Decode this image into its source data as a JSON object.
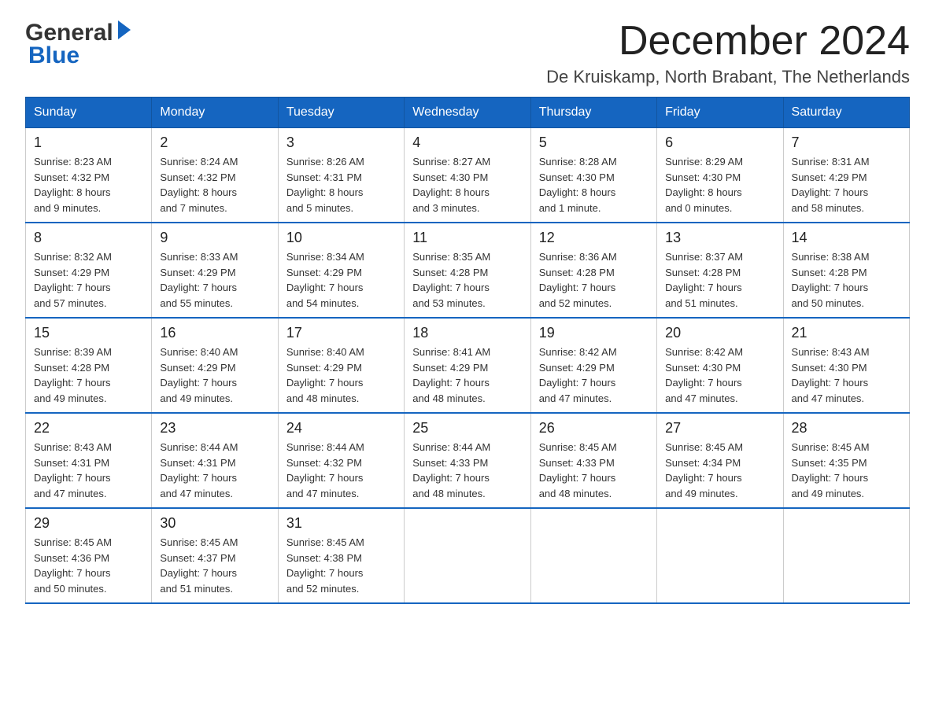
{
  "logo": {
    "general": "General",
    "blue": "Blue"
  },
  "title": "December 2024",
  "subtitle": "De Kruiskamp, North Brabant, The Netherlands",
  "weekdays": [
    "Sunday",
    "Monday",
    "Tuesday",
    "Wednesday",
    "Thursday",
    "Friday",
    "Saturday"
  ],
  "weeks": [
    [
      {
        "day": "1",
        "sunrise": "8:23 AM",
        "sunset": "4:32 PM",
        "daylight": "8 hours and 9 minutes."
      },
      {
        "day": "2",
        "sunrise": "8:24 AM",
        "sunset": "4:32 PM",
        "daylight": "8 hours and 7 minutes."
      },
      {
        "day": "3",
        "sunrise": "8:26 AM",
        "sunset": "4:31 PM",
        "daylight": "8 hours and 5 minutes."
      },
      {
        "day": "4",
        "sunrise": "8:27 AM",
        "sunset": "4:30 PM",
        "daylight": "8 hours and 3 minutes."
      },
      {
        "day": "5",
        "sunrise": "8:28 AM",
        "sunset": "4:30 PM",
        "daylight": "8 hours and 1 minute."
      },
      {
        "day": "6",
        "sunrise": "8:29 AM",
        "sunset": "4:30 PM",
        "daylight": "8 hours and 0 minutes."
      },
      {
        "day": "7",
        "sunrise": "8:31 AM",
        "sunset": "4:29 PM",
        "daylight": "7 hours and 58 minutes."
      }
    ],
    [
      {
        "day": "8",
        "sunrise": "8:32 AM",
        "sunset": "4:29 PM",
        "daylight": "7 hours and 57 minutes."
      },
      {
        "day": "9",
        "sunrise": "8:33 AM",
        "sunset": "4:29 PM",
        "daylight": "7 hours and 55 minutes."
      },
      {
        "day": "10",
        "sunrise": "8:34 AM",
        "sunset": "4:29 PM",
        "daylight": "7 hours and 54 minutes."
      },
      {
        "day": "11",
        "sunrise": "8:35 AM",
        "sunset": "4:28 PM",
        "daylight": "7 hours and 53 minutes."
      },
      {
        "day": "12",
        "sunrise": "8:36 AM",
        "sunset": "4:28 PM",
        "daylight": "7 hours and 52 minutes."
      },
      {
        "day": "13",
        "sunrise": "8:37 AM",
        "sunset": "4:28 PM",
        "daylight": "7 hours and 51 minutes."
      },
      {
        "day": "14",
        "sunrise": "8:38 AM",
        "sunset": "4:28 PM",
        "daylight": "7 hours and 50 minutes."
      }
    ],
    [
      {
        "day": "15",
        "sunrise": "8:39 AM",
        "sunset": "4:28 PM",
        "daylight": "7 hours and 49 minutes."
      },
      {
        "day": "16",
        "sunrise": "8:40 AM",
        "sunset": "4:29 PM",
        "daylight": "7 hours and 49 minutes."
      },
      {
        "day": "17",
        "sunrise": "8:40 AM",
        "sunset": "4:29 PM",
        "daylight": "7 hours and 48 minutes."
      },
      {
        "day": "18",
        "sunrise": "8:41 AM",
        "sunset": "4:29 PM",
        "daylight": "7 hours and 48 minutes."
      },
      {
        "day": "19",
        "sunrise": "8:42 AM",
        "sunset": "4:29 PM",
        "daylight": "7 hours and 47 minutes."
      },
      {
        "day": "20",
        "sunrise": "8:42 AM",
        "sunset": "4:30 PM",
        "daylight": "7 hours and 47 minutes."
      },
      {
        "day": "21",
        "sunrise": "8:43 AM",
        "sunset": "4:30 PM",
        "daylight": "7 hours and 47 minutes."
      }
    ],
    [
      {
        "day": "22",
        "sunrise": "8:43 AM",
        "sunset": "4:31 PM",
        "daylight": "7 hours and 47 minutes."
      },
      {
        "day": "23",
        "sunrise": "8:44 AM",
        "sunset": "4:31 PM",
        "daylight": "7 hours and 47 minutes."
      },
      {
        "day": "24",
        "sunrise": "8:44 AM",
        "sunset": "4:32 PM",
        "daylight": "7 hours and 47 minutes."
      },
      {
        "day": "25",
        "sunrise": "8:44 AM",
        "sunset": "4:33 PM",
        "daylight": "7 hours and 48 minutes."
      },
      {
        "day": "26",
        "sunrise": "8:45 AM",
        "sunset": "4:33 PM",
        "daylight": "7 hours and 48 minutes."
      },
      {
        "day": "27",
        "sunrise": "8:45 AM",
        "sunset": "4:34 PM",
        "daylight": "7 hours and 49 minutes."
      },
      {
        "day": "28",
        "sunrise": "8:45 AM",
        "sunset": "4:35 PM",
        "daylight": "7 hours and 49 minutes."
      }
    ],
    [
      {
        "day": "29",
        "sunrise": "8:45 AM",
        "sunset": "4:36 PM",
        "daylight": "7 hours and 50 minutes."
      },
      {
        "day": "30",
        "sunrise": "8:45 AM",
        "sunset": "4:37 PM",
        "daylight": "7 hours and 51 minutes."
      },
      {
        "day": "31",
        "sunrise": "8:45 AM",
        "sunset": "4:38 PM",
        "daylight": "7 hours and 52 minutes."
      },
      null,
      null,
      null,
      null
    ]
  ],
  "labels": {
    "sunrise": "Sunrise:",
    "sunset": "Sunset:",
    "daylight": "Daylight:"
  }
}
